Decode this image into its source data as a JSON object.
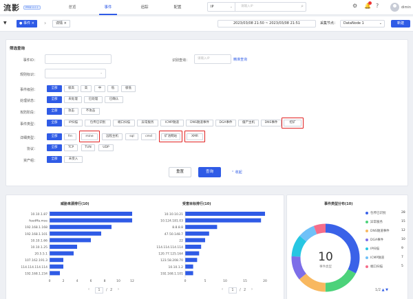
{
  "app": {
    "logo": "流影",
    "version": "PPBE.0.0.1"
  },
  "nav": [
    "总览",
    "事件",
    "追踪",
    "配置"
  ],
  "search": {
    "selected": "IP",
    "placeholder": "请输入IP"
  },
  "user": {
    "name": "dimin"
  },
  "tabs": {
    "active": "事件",
    "second": "详情"
  },
  "datetime": "2023/03/08 21:50 ~ 2023/03/08 21:51",
  "datasource": {
    "label": "采集节点：",
    "value": "DataNode 1"
  },
  "new_button": "新建",
  "filter": {
    "title": "筛选查询",
    "fields": {
      "event_id_label": "事件ID：",
      "ip_label": "识别查询：",
      "ip_placeholder": "请输入IP",
      "exact_link": "精准查询",
      "rule_label": "规则标识："
    },
    "rows": [
      {
        "label": "事件级别：",
        "chips": [
          "全部",
          "极高",
          "高",
          "中",
          "低",
          "极低"
        ]
      },
      {
        "label": "处理状态：",
        "chips": [
          "全部",
          "未处理",
          "已处理",
          "已确认"
        ]
      },
      {
        "label": "攻防阶段：",
        "chips": [
          "全部",
          "攻击",
          "不攻击"
        ]
      },
      {
        "label": "事件类型：",
        "chips": [
          "全部",
          "IP扫描",
          "包传已识别",
          "端口扫描",
          "异常服务",
          "ICMP隧道",
          "DNS隧道事件",
          "DGA事件",
          "僵尸主机",
          "DNS事件",
          "挖矿"
        ]
      },
      {
        "label": "详细类型：",
        "chips": [
          "全部",
          "frn",
          "mine",
          "远程主机",
          "sql",
          "cmd",
          "矿池网站",
          "XMR"
        ]
      },
      {
        "label": "协议：",
        "chips": [
          "全部",
          "TCP",
          "TUN",
          "UDP"
        ]
      },
      {
        "label": "资产组：",
        "chips": [
          "全部",
          "未受入"
        ]
      }
    ],
    "buttons": {
      "reset": "重置",
      "query": "查询",
      "collapse": "收起"
    }
  },
  "charts": {
    "left_title": "威胁来源排行(10)",
    "middle_title": "受害目标排行(10)",
    "right_title": "事件类型分布(10)",
    "pager_left": {
      "current": "1",
      "total": "2"
    },
    "pager_middle": {
      "current": "1",
      "total": "2"
    },
    "pie_pager": "1/2",
    "donut_center": {
      "value": "10",
      "label": "事件类型"
    }
  },
  "colors": {
    "accent": "#2f5be6",
    "highlight": "#e02020"
  },
  "chart_data": [
    {
      "type": "bar",
      "title": "威胁来源排行(10)",
      "categories": [
        "10.10.1.87",
        "feedffa.mse",
        "192.168.1.168",
        "192.168.1.101",
        "10.10.1.66",
        "10.10.1.25",
        "20.5.5.1",
        "107.162.191.3",
        "114.114.114.114",
        "192.168.1.234"
      ],
      "values": [
        12,
        12,
        9,
        7.5,
        6,
        4,
        3.5,
        2,
        2,
        1.5
      ],
      "xlim": [
        0,
        12
      ],
      "xticks": [
        0,
        2,
        4,
        6,
        8,
        10,
        12
      ]
    },
    {
      "type": "bar",
      "title": "受害目标排行(10)",
      "categories": [
        "10.10.10.21",
        "10.124.181.03",
        "8.8.8.8",
        "47.50.148.7",
        "22",
        "114.114.114.114",
        "120.77.125.164",
        "123.58.208.70",
        "10.10.1.2",
        "192.168.1.101"
      ],
      "values": [
        20,
        19,
        8,
        6,
        5,
        4,
        3.5,
        3,
        2,
        2
      ],
      "xlim": [
        0,
        20
      ],
      "xticks": [
        0,
        5,
        10,
        15,
        20
      ]
    },
    {
      "type": "pie",
      "title": "事件类型分布(10)",
      "center_value": "10",
      "center_label": "事件类型",
      "slices": [
        {
          "name": "包传已识别",
          "value": 28,
          "color": "#3a62e8"
        },
        {
          "name": "异常服务",
          "value": 15,
          "color": "#4cd27a"
        },
        {
          "name": "DNS隧道事件",
          "value": 12,
          "color": "#f8b860"
        },
        {
          "name": "DGA事件",
          "value": 10,
          "color": "#7d6ee8"
        },
        {
          "name": "IP扫描",
          "value": 9,
          "color": "#27c6e2"
        },
        {
          "name": "ICMP隧道",
          "value": 7,
          "color": "#6fc1f8"
        },
        {
          "name": "端口扫描",
          "value": 5,
          "color": "#f56d8a"
        }
      ]
    }
  ]
}
